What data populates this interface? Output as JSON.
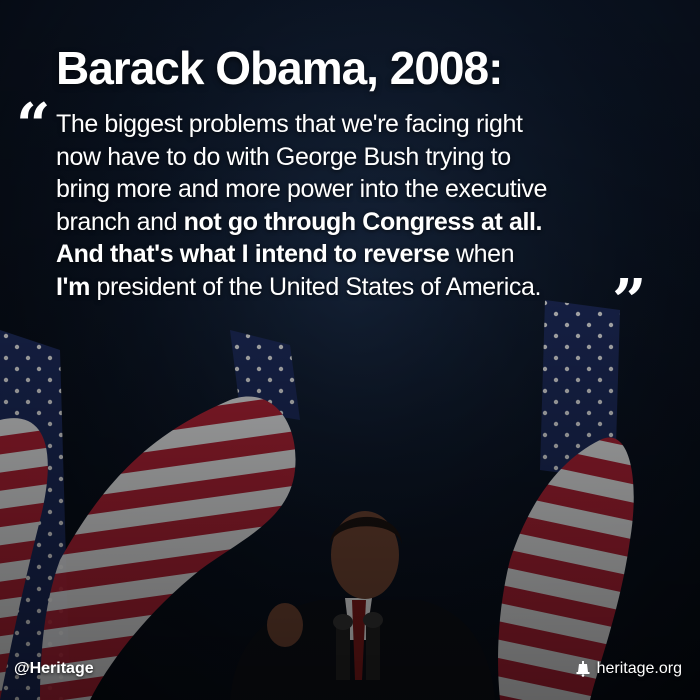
{
  "headline": "Barack Obama, 2008:",
  "quote": {
    "open_mark": "“",
    "close_mark": "”",
    "line1": "The biggest problems that we're facing right",
    "line2": "now have to do with George Bush trying to",
    "line3": "bring more and more power into the executive",
    "line4_start": "branch and ",
    "line4_bold": "not go through Congress at all.",
    "line5_bold": "And that's what I intend to reverse",
    "line5_end": " when",
    "line6_bold": "I'm",
    "line6_end": " president of the United States of America."
  },
  "footer": {
    "handle": "@Heritage",
    "site": "heritage.org",
    "site_icon": "liberty-bell-icon"
  },
  "colors": {
    "background": "#0a1322",
    "text": "#ffffff",
    "flag_red": "#b22234",
    "flag_white": "#f2f2f2",
    "flag_blue": "#1c2a5a",
    "suit": "#0c0f16",
    "skin": "#6a4130"
  }
}
